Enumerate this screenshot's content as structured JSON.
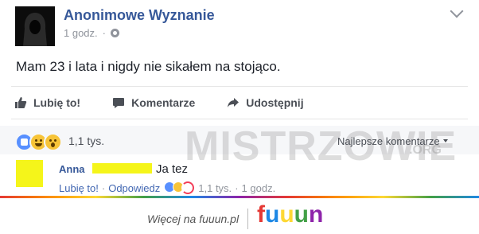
{
  "post": {
    "author": "Anonimowe Wyznanie",
    "time": "1 godz.",
    "text": "Mam 23 i lata i nigdy nie sikałem na stojąco.",
    "actions": {
      "like": "Lubię to!",
      "comment": "Komentarze",
      "share": "Udostępnij"
    },
    "reactions_count": "1,1 tys.",
    "sort_label": "Najlepsze komentarze",
    "reaction_icons": [
      "like-icon",
      "haha-icon",
      "wow-icon"
    ]
  },
  "comment": {
    "author": "Anna",
    "text": "Ja tez",
    "like_label": "Lubię to!",
    "reply_label": "Odpowiedz",
    "reactions_count": "1,1 tys.",
    "time": "1 godz."
  },
  "watermark": {
    "brand": "MISTRZOWIE",
    "tld": ".ORG"
  },
  "footer": {
    "text": "Więcej na fuuun.pl",
    "logo_letters": [
      "f",
      "u",
      "u",
      "u",
      "n"
    ],
    "logo_colors": [
      "#e53935",
      "#1e88e5",
      "#fdd835",
      "#43a047",
      "#8e24aa"
    ]
  },
  "colors": {
    "link": "#365899",
    "text": "#1d2129",
    "muted": "#90949c",
    "redaction": "#f5f51a"
  }
}
